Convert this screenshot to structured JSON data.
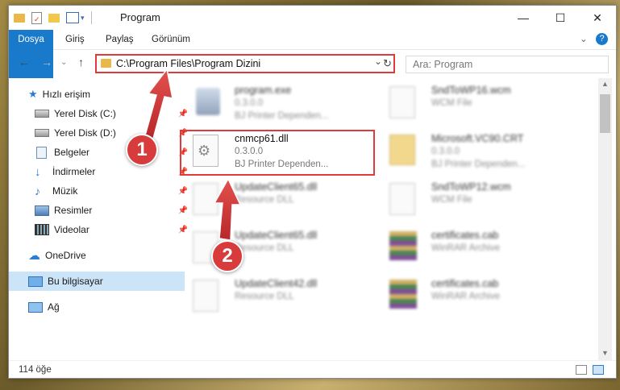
{
  "window": {
    "title": "Program",
    "min": "—",
    "max": "☐",
    "close": "✕"
  },
  "ribbon": {
    "tabs": [
      "Dosya",
      "Giriş",
      "Paylaş",
      "Görünüm"
    ],
    "collapse": "⌄",
    "help": "?"
  },
  "address": {
    "path": "C:\\Program Files\\Program Dizini",
    "dropdown": "⌄",
    "refresh": "↻"
  },
  "search": {
    "placeholder": "Ara: Program"
  },
  "nav_buttons": {
    "back": "←",
    "forward": "→",
    "recent": "⌄",
    "up": "↑"
  },
  "sidebar": {
    "items": [
      {
        "label": "Hızlı erişim",
        "icon": "star-icon"
      },
      {
        "label": "Yerel Disk (C:)",
        "icon": "drive-icon",
        "pinned": true
      },
      {
        "label": "Yerel Disk (D:)",
        "icon": "drive-icon",
        "pinned": true
      },
      {
        "label": "Belgeler",
        "icon": "documents-icon",
        "pinned": true
      },
      {
        "label": "İndirmeler",
        "icon": "download-icon",
        "pinned": true
      },
      {
        "label": "Müzik",
        "icon": "music-icon",
        "pinned": true
      },
      {
        "label": "Resimler",
        "icon": "pictures-icon",
        "pinned": true
      },
      {
        "label": "Videolar",
        "icon": "videos-icon",
        "pinned": true
      },
      {
        "label": "OneDrive",
        "icon": "cloud-icon"
      },
      {
        "label": "Bu bilgisayar",
        "icon": "computer-icon",
        "selected": true
      },
      {
        "label": "Ağ",
        "icon": "network-icon"
      }
    ]
  },
  "files": [
    {
      "name": "program.exe",
      "line1": "0.3.0.0",
      "line2": "BJ Printer Dependen...",
      "icon": "exe-icon"
    },
    {
      "name": "SndToWP16.wcm",
      "line1": "WCM File",
      "line2": "",
      "icon": "file-icon"
    },
    {
      "name": "cnmcp61.dll",
      "line1": "0.3.0.0",
      "line2": "BJ Printer Dependen...",
      "icon": "dll-gear-icon"
    },
    {
      "name": "Microsoft.VC90.CRT",
      "line1": "0.3.0.0",
      "line2": "BJ Printer Dependen...",
      "icon": "zip-folder-icon"
    },
    {
      "name": "UpdateClient65.dll",
      "line1": "Resource DLL",
      "line2": "",
      "icon": "dll-gear-icon"
    },
    {
      "name": "SndToWP12.wcm",
      "line1": "WCM File",
      "line2": "",
      "icon": "file-icon"
    },
    {
      "name": "UpdateClient65.dll",
      "line1": "Resource DLL",
      "line2": "",
      "icon": "dll-gear-icon"
    },
    {
      "name": "certificates.cab",
      "line1": "WinRAR Archive",
      "line2": "",
      "icon": "winrar-icon"
    },
    {
      "name": "UpdateClient42.dll",
      "line1": "Resource DLL",
      "line2": "",
      "icon": "dll-gear-icon"
    },
    {
      "name": "certificates.cab",
      "line1": "WinRAR Archive",
      "line2": "",
      "icon": "winrar-icon"
    }
  ],
  "status": {
    "count": "114 öğe"
  },
  "callouts": [
    "1",
    "2"
  ],
  "colors": {
    "accent": "#1979ca",
    "highlight": "#e03b3b",
    "selected": "#cce4f7"
  }
}
